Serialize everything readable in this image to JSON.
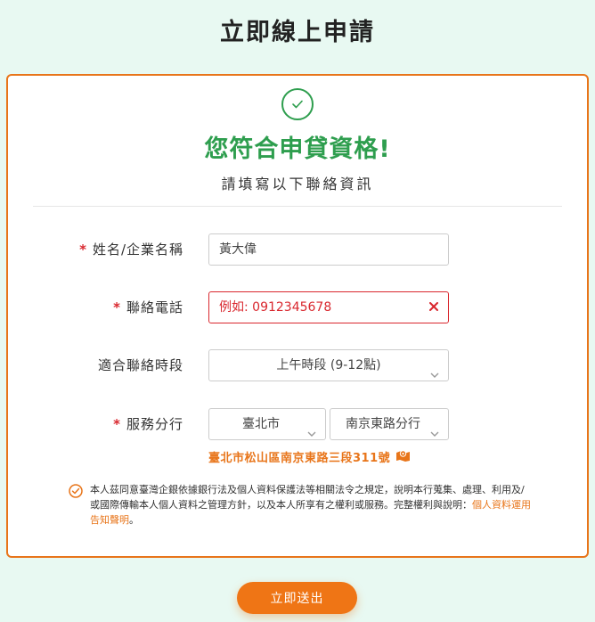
{
  "page": {
    "title": "立即線上申請"
  },
  "result": {
    "headline": "您符合申貸資格!",
    "subhead": "請填寫以下聯絡資訊"
  },
  "form": {
    "name": {
      "required_mark": "*",
      "label": "姓名/企業名稱",
      "value": "黃大偉"
    },
    "phone": {
      "required_mark": "*",
      "label": "聯絡電話",
      "placeholder": "例如: 0912345678",
      "state": "error"
    },
    "contact_time": {
      "label": "適合聯絡時段",
      "selected": "上午時段 (9-12點)"
    },
    "branch": {
      "required_mark": "*",
      "label": "服務分行",
      "city_selected": "臺北市",
      "branch_selected": "南京東路分行",
      "address": "臺北市松山區南京東路三段311號"
    }
  },
  "consent": {
    "checked": true,
    "text": "本人茲同意臺灣企銀依據銀行法及個人資料保護法等相關法令之規定，說明本行蒐集、處理、利用及/或國際傳輸本人個人資料之管理方針，以及本人所享有之權利或服務。完整權利與說明：",
    "link_text": "個人資料運用告知聲明",
    "end": "。"
  },
  "submit": {
    "label": "立即送出"
  },
  "colors": {
    "accent": "#ef7515",
    "success": "#2e9e4e",
    "error": "#d9272e",
    "background": "#e8f9f2"
  }
}
